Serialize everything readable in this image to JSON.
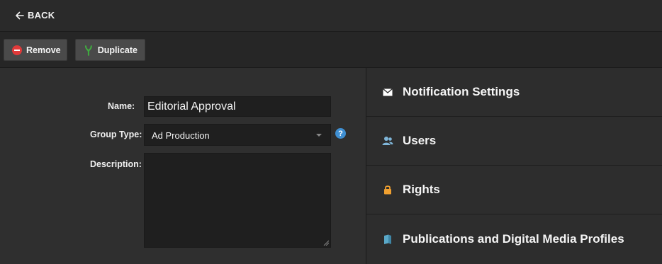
{
  "header": {
    "back_label": "BACK"
  },
  "toolbar": {
    "remove_label": "Remove",
    "duplicate_label": "Duplicate"
  },
  "form": {
    "name_label": "Name:",
    "name_value": "Editorial Approval",
    "group_type_label": "Group Type:",
    "group_type_value": "Ad Production",
    "description_label": "Description:",
    "description_value": "",
    "help_glyph": "?"
  },
  "sections": [
    {
      "label": "Notification Settings",
      "icon": "envelope-icon"
    },
    {
      "label": "Users",
      "icon": "users-icon"
    },
    {
      "label": "Rights",
      "icon": "lock-icon"
    },
    {
      "label": "Publications and Digital Media Profiles",
      "icon": "book-icon"
    }
  ],
  "colors": {
    "remove_red": "#e03a3a",
    "duplicate_green": "#3fae3f",
    "help_blue": "#3f8fd2",
    "users_blue": "#7fb6d9",
    "lock_orange": "#f0a030",
    "book_teal": "#5aa8c8"
  }
}
